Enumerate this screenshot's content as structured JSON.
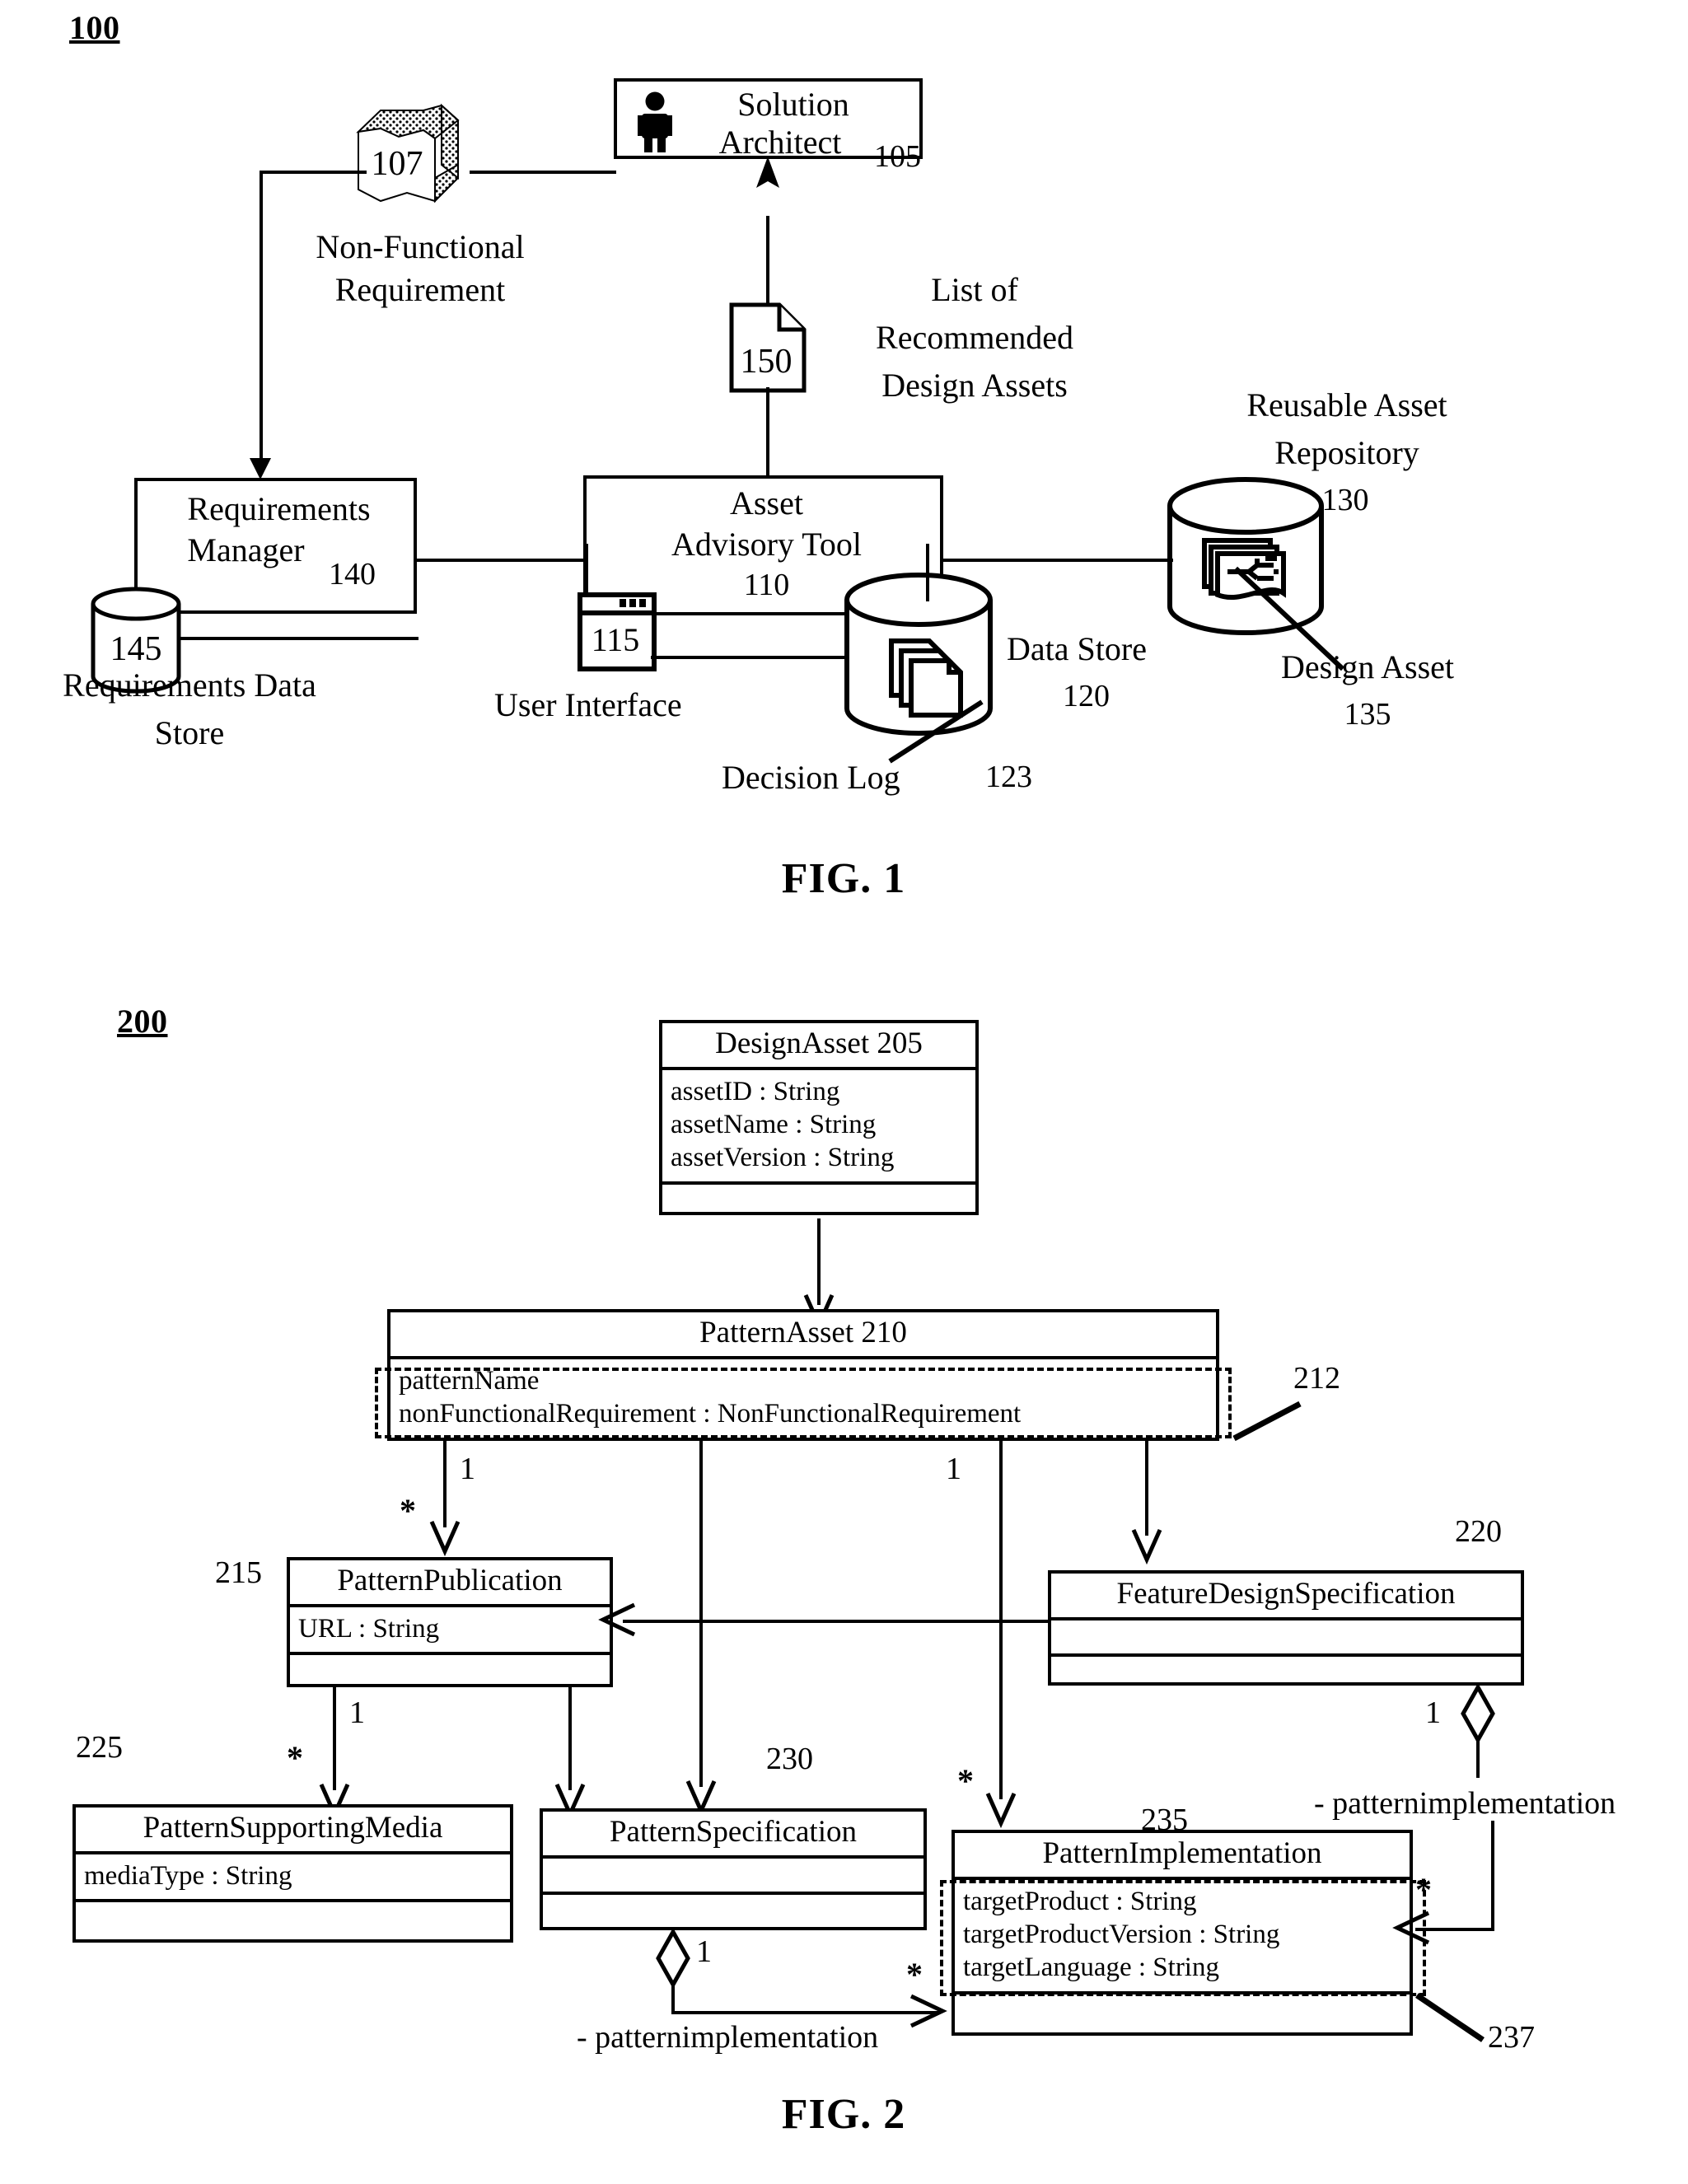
{
  "fig1": {
    "fignum": "100",
    "caption": "FIG. 1",
    "nodes": {
      "solution_architect": {
        "label_line1": "Solution",
        "label_line2": "Architect",
        "ref": "105",
        "icon": "person-icon"
      },
      "non_functional_requirement": {
        "ref": "107",
        "label_line1": "Non-Functional",
        "label_line2": "Requirement",
        "icon": "document-3d-icon"
      },
      "list_of_recommended": {
        "ref": "150",
        "label_line1": "List of",
        "label_line2": "Recommended",
        "label_line3": "Design Assets",
        "icon": "page-icon"
      },
      "requirements_manager": {
        "label_line1": "Requirements",
        "label_line2": "Manager",
        "ref": "140"
      },
      "requirements_data_store": {
        "ref": "145",
        "label_line1": "Requirements Data",
        "label_line2": "Store",
        "icon": "cylinder-icon"
      },
      "asset_advisory_tool": {
        "label_line1": "Asset",
        "label_line2": "Advisory Tool",
        "ref": "110"
      },
      "user_interface": {
        "ref": "115",
        "label": "User Interface",
        "icon": "window-icon"
      },
      "data_store": {
        "label": "Data Store",
        "ref": "120",
        "icon": "cylinder-icon"
      },
      "decision_log": {
        "label": "Decision Log",
        "ref": "123",
        "icon": "pages-stack-icon"
      },
      "reusable_asset_repository": {
        "label_line1": "Reusable Asset",
        "label_line2": "Repository",
        "ref": "130",
        "icon": "cylinder-icon"
      },
      "design_asset": {
        "label": "Design Asset",
        "ref": "135",
        "icon": "asset-icon"
      }
    }
  },
  "fig2": {
    "fignum": "200",
    "caption": "FIG. 2",
    "classes": {
      "design_asset": {
        "title": "DesignAsset  205",
        "attrs": [
          "assetID : String",
          "assetName : String",
          "assetVersion : String"
        ]
      },
      "pattern_asset": {
        "title": "PatternAsset  210",
        "attrs": [
          "patternName",
          "nonFunctionalRequirement : NonFunctionalRequirement"
        ],
        "callout": "212"
      },
      "pattern_publication": {
        "ref": "215",
        "title": "PatternPublication",
        "attrs": [
          "URL : String"
        ]
      },
      "feature_design_specification": {
        "ref": "220",
        "title": "FeatureDesignSpecification",
        "attrs": []
      },
      "pattern_supporting_media": {
        "ref": "225",
        "title": "PatternSupportingMedia",
        "attrs": [
          "mediaType : String"
        ]
      },
      "pattern_specification": {
        "ref": "230",
        "title": "PatternSpecification",
        "attrs": []
      },
      "pattern_implementation": {
        "ref": "235",
        "title": "PatternImplementation",
        "attrs": [
          "targetProduct : String",
          "targetProductVersion : String",
          "targetLanguage : String"
        ],
        "callout": "237"
      }
    },
    "multiplicities": {
      "pub_one": "1",
      "pub_star": "*",
      "impl_one": "1",
      "impl_star": "*",
      "media_one": "1",
      "media_star": "*",
      "spec_one": "1",
      "spec_star": "*",
      "fds_one": "1",
      "right_star": "*",
      "left_star": "*"
    },
    "role_labels": {
      "left": "- patternimplementation",
      "right": "- patternimplementation"
    }
  },
  "colors": {
    "ink": "#000000",
    "paper": "#ffffff"
  }
}
